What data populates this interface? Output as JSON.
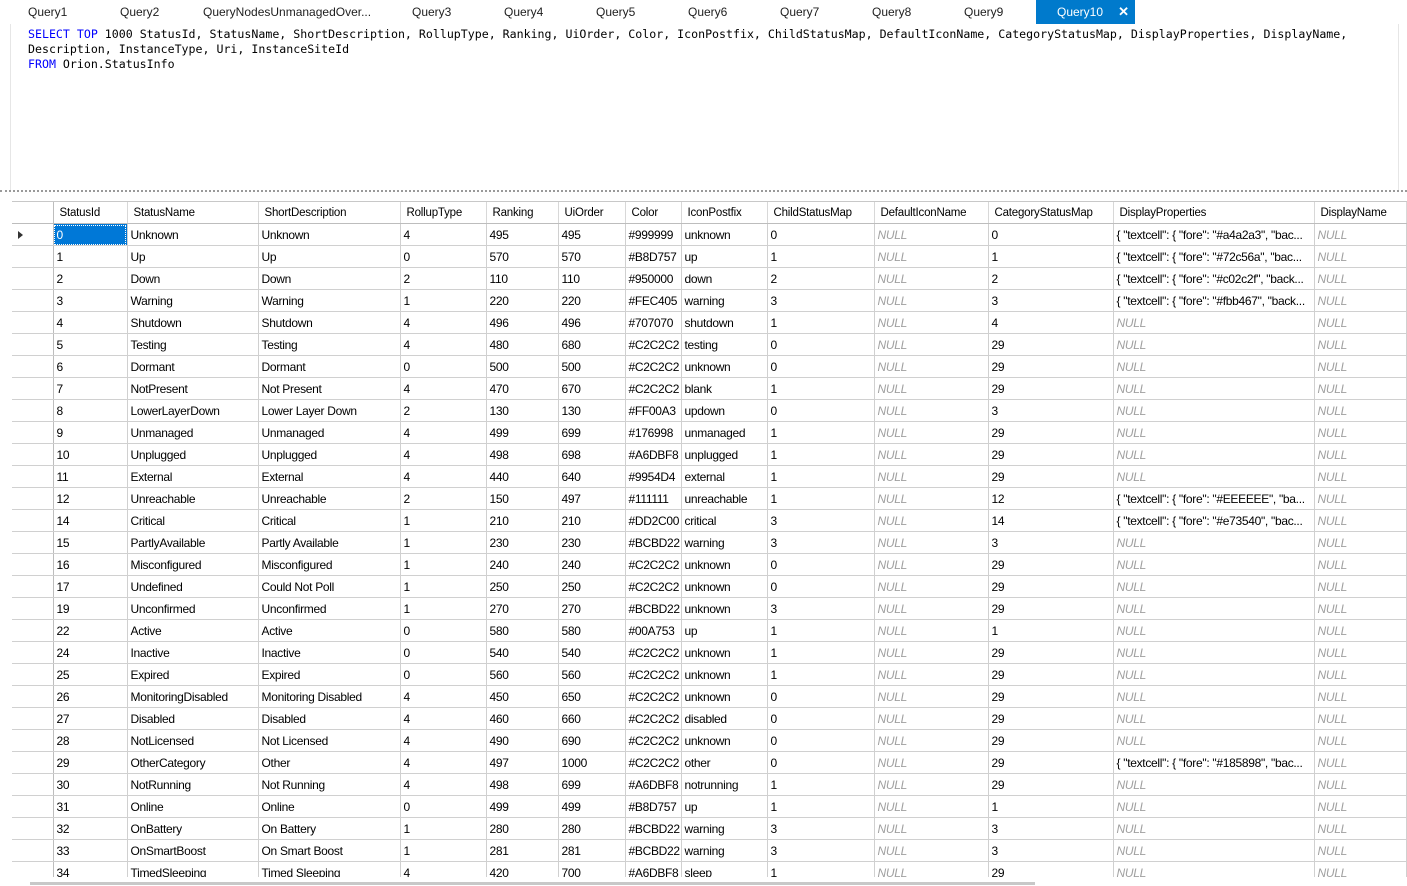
{
  "tabs": [
    {
      "label": "Query1"
    },
    {
      "label": "Query2"
    },
    {
      "label": "QueryNodesUnmanagedOver..."
    },
    {
      "label": "Query3"
    },
    {
      "label": "Query4"
    },
    {
      "label": "Query5"
    },
    {
      "label": "Query6"
    },
    {
      "label": "Query7"
    },
    {
      "label": "Query8"
    },
    {
      "label": "Query9"
    },
    {
      "label": "Query10",
      "active": true
    }
  ],
  "tab_close_glyph": "✕",
  "editor": {
    "line1_kw": "SELECT TOP",
    "line1_rest": " 1000 StatusId, StatusName, ShortDescription, RollupType, Ranking, UiOrder, Color, IconPostfix, ChildStatusMap, DefaultIconName, CategoryStatusMap, DisplayProperties, DisplayName,",
    "line2": "Description, InstanceType, Uri, InstanceSiteId",
    "line3_kw": "FROM",
    "line3_rest": " Orion.StatusInfo"
  },
  "grid": {
    "columns": [
      "StatusId",
      "StatusName",
      "ShortDescription",
      "RollupType",
      "Ranking",
      "UiOrder",
      "Color",
      "IconPostfix",
      "ChildStatusMap",
      "DefaultIconName",
      "CategoryStatusMap",
      "DisplayProperties",
      "DisplayName"
    ],
    "null_text": "NULL",
    "rows": [
      [
        "0",
        "Unknown",
        "Unknown",
        "4",
        "495",
        "495",
        "#999999",
        "unknown",
        "0",
        "NULL",
        "0",
        "{ \"textcell\": { \"fore\": \"#a4a2a3\", \"bac...",
        "NULL"
      ],
      [
        "1",
        "Up",
        "Up",
        "0",
        "570",
        "570",
        "#B8D757",
        "up",
        "1",
        "NULL",
        "1",
        "{ \"textcell\": { \"fore\": \"#72c56a\", \"bac...",
        "NULL"
      ],
      [
        "2",
        "Down",
        "Down",
        "2",
        "110",
        "110",
        "#950000",
        "down",
        "2",
        "NULL",
        "2",
        "{ \"textcell\": { \"fore\": \"#c02c2f\", \"back...",
        "NULL"
      ],
      [
        "3",
        "Warning",
        "Warning",
        "1",
        "220",
        "220",
        "#FEC405",
        "warning",
        "3",
        "NULL",
        "3",
        "{ \"textcell\": { \"fore\": \"#fbb467\", \"back...",
        "NULL"
      ],
      [
        "4",
        "Shutdown",
        "Shutdown",
        "4",
        "496",
        "496",
        "#707070",
        "shutdown",
        "1",
        "NULL",
        "4",
        "NULL",
        "NULL"
      ],
      [
        "5",
        "Testing",
        "Testing",
        "4",
        "480",
        "680",
        "#C2C2C2",
        "testing",
        "0",
        "NULL",
        "29",
        "NULL",
        "NULL"
      ],
      [
        "6",
        "Dormant",
        "Dormant",
        "0",
        "500",
        "500",
        "#C2C2C2",
        "unknown",
        "0",
        "NULL",
        "29",
        "NULL",
        "NULL"
      ],
      [
        "7",
        "NotPresent",
        "Not Present",
        "4",
        "470",
        "670",
        "#C2C2C2",
        "blank",
        "1",
        "NULL",
        "29",
        "NULL",
        "NULL"
      ],
      [
        "8",
        "LowerLayerDown",
        "Lower Layer Down",
        "2",
        "130",
        "130",
        "#FF00A3",
        "updown",
        "0",
        "NULL",
        "3",
        "NULL",
        "NULL"
      ],
      [
        "9",
        "Unmanaged",
        "Unmanaged",
        "4",
        "499",
        "699",
        "#176998",
        "unmanaged",
        "1",
        "NULL",
        "29",
        "NULL",
        "NULL"
      ],
      [
        "10",
        "Unplugged",
        "Unplugged",
        "4",
        "498",
        "698",
        "#A6DBF8",
        "unplugged",
        "1",
        "NULL",
        "29",
        "NULL",
        "NULL"
      ],
      [
        "11",
        "External",
        "External",
        "4",
        "440",
        "640",
        "#9954D4",
        "external",
        "1",
        "NULL",
        "29",
        "NULL",
        "NULL"
      ],
      [
        "12",
        "Unreachable",
        "Unreachable",
        "2",
        "150",
        "497",
        "#111111",
        "unreachable",
        "1",
        "NULL",
        "12",
        "{ \"textcell\": { \"fore\": \"#EEEEEE\", \"ba...",
        "NULL"
      ],
      [
        "14",
        "Critical",
        "Critical",
        "1",
        "210",
        "210",
        "#DD2C00",
        "critical",
        "3",
        "NULL",
        "14",
        "{ \"textcell\": { \"fore\": \"#e73540\", \"bac...",
        "NULL"
      ],
      [
        "15",
        "PartlyAvailable",
        "Partly Available",
        "1",
        "230",
        "230",
        "#BCBD22",
        "warning",
        "3",
        "NULL",
        "3",
        "NULL",
        "NULL"
      ],
      [
        "16",
        "Misconfigured",
        "Misconfigured",
        "1",
        "240",
        "240",
        "#C2C2C2",
        "unknown",
        "0",
        "NULL",
        "29",
        "NULL",
        "NULL"
      ],
      [
        "17",
        "Undefined",
        "Could Not Poll",
        "1",
        "250",
        "250",
        "#C2C2C2",
        "unknown",
        "0",
        "NULL",
        "29",
        "NULL",
        "NULL"
      ],
      [
        "19",
        "Unconfirmed",
        "Unconfirmed",
        "1",
        "270",
        "270",
        "#BCBD22",
        "unknown",
        "3",
        "NULL",
        "29",
        "NULL",
        "NULL"
      ],
      [
        "22",
        "Active",
        "Active",
        "0",
        "580",
        "580",
        "#00A753",
        "up",
        "1",
        "NULL",
        "1",
        "NULL",
        "NULL"
      ],
      [
        "24",
        "Inactive",
        "Inactive",
        "0",
        "540",
        "540",
        "#C2C2C2",
        "unknown",
        "1",
        "NULL",
        "29",
        "NULL",
        "NULL"
      ],
      [
        "25",
        "Expired",
        "Expired",
        "0",
        "560",
        "560",
        "#C2C2C2",
        "unknown",
        "1",
        "NULL",
        "29",
        "NULL",
        "NULL"
      ],
      [
        "26",
        "MonitoringDisabled",
        "Monitoring Disabled",
        "4",
        "450",
        "650",
        "#C2C2C2",
        "unknown",
        "0",
        "NULL",
        "29",
        "NULL",
        "NULL"
      ],
      [
        "27",
        "Disabled",
        "Disabled",
        "4",
        "460",
        "660",
        "#C2C2C2",
        "disabled",
        "0",
        "NULL",
        "29",
        "NULL",
        "NULL"
      ],
      [
        "28",
        "NotLicensed",
        "Not Licensed",
        "4",
        "490",
        "690",
        "#C2C2C2",
        "unknown",
        "0",
        "NULL",
        "29",
        "NULL",
        "NULL"
      ],
      [
        "29",
        "OtherCategory",
        "Other",
        "4",
        "497",
        "1000",
        "#C2C2C2",
        "other",
        "0",
        "NULL",
        "29",
        "{ \"textcell\": { \"fore\": \"#185898\", \"bac...",
        "NULL"
      ],
      [
        "30",
        "NotRunning",
        "Not Running",
        "4",
        "498",
        "699",
        "#A6DBF8",
        "notrunning",
        "1",
        "NULL",
        "29",
        "NULL",
        "NULL"
      ],
      [
        "31",
        "Online",
        "Online",
        "0",
        "499",
        "499",
        "#B8D757",
        "up",
        "1",
        "NULL",
        "1",
        "NULL",
        "NULL"
      ],
      [
        "32",
        "OnBattery",
        "On Battery",
        "1",
        "280",
        "280",
        "#BCBD22",
        "warning",
        "3",
        "NULL",
        "3",
        "NULL",
        "NULL"
      ],
      [
        "33",
        "OnSmartBoost",
        "On Smart Boost",
        "1",
        "281",
        "281",
        "#BCBD22",
        "warning",
        "3",
        "NULL",
        "3",
        "NULL",
        "NULL"
      ],
      [
        "34",
        "TimedSleeping",
        "Timed Sleeping",
        "4",
        "420",
        "700",
        "#A6DBF8",
        "sleep",
        "1",
        "NULL",
        "29",
        "NULL",
        "NULL"
      ]
    ]
  },
  "colors": {
    "accent": "#007acc",
    "keyword": "#0000ff",
    "selection": "#0078d7",
    "null_text": "#a0a0a0"
  }
}
